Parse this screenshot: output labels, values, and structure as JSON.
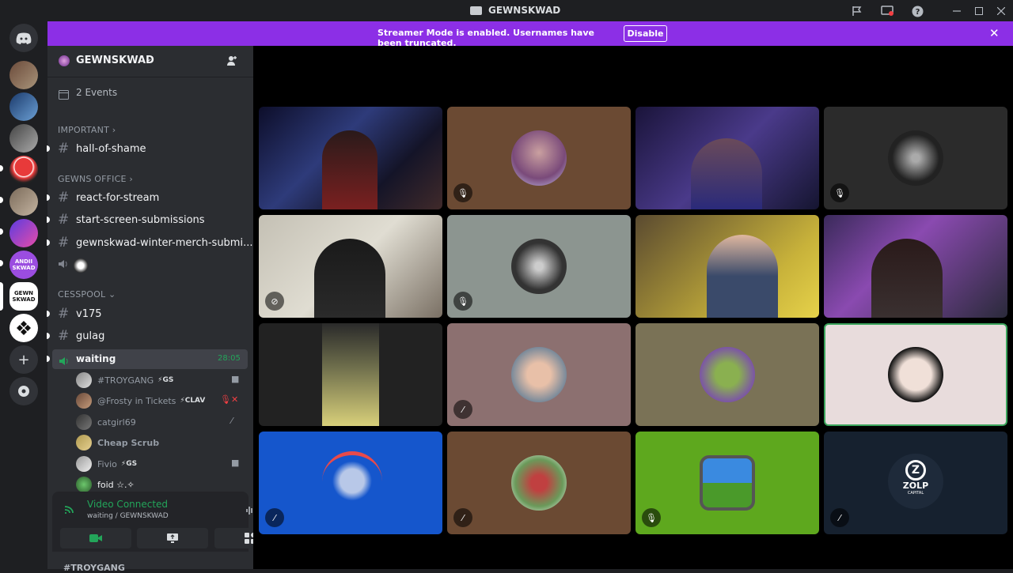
{
  "window": {
    "title": "GEWNSKWAD"
  },
  "banner": {
    "text": "Streamer Mode is enabled. Usernames have been truncated.",
    "button": "Disable",
    "color": "#8c2fe6"
  },
  "guild": {
    "name": "GEWNSKWAD",
    "events": "2 Events"
  },
  "categories": {
    "important": "IMPORTANT",
    "office": "GEWNS OFFICE",
    "cesspool": "CESSPOOL"
  },
  "channels": {
    "hall": "hall-of-shame",
    "react": "react-for-stream",
    "start": "start-screen-submissions",
    "merch": "gewnskwad-winter-merch-submi...",
    "v175": "v175",
    "gulag": "gulag",
    "waiting": "waiting",
    "waiting_time": "28:05"
  },
  "voice_users": [
    {
      "name": "#TROYGANG",
      "tag": "⚡GS"
    },
    {
      "name": "@Frosty in Tickets",
      "tag": "⚡CLAV"
    },
    {
      "name": "catgirl69",
      "tag": ""
    },
    {
      "name": "Cheap Scrub",
      "tag": ""
    },
    {
      "name": "Fivio",
      "tag": "⚡GS"
    },
    {
      "name": "foid ☆.✧",
      "tag": ""
    }
  ],
  "voice_panel": {
    "status": "Video Connected",
    "sub": "waiting / GEWNSKWAD"
  },
  "next_user": "#TROYGANG",
  "brand_logo": {
    "text": "ZOLP",
    "sub": "CAPITAL"
  },
  "server_icons": {
    "andii": "ANDII SKWAD",
    "gewn": "GEWN SKWAD"
  },
  "colors": {
    "accent_green": "#23a55a",
    "blurple": "#5865f2",
    "bg": "#1e1f22"
  }
}
